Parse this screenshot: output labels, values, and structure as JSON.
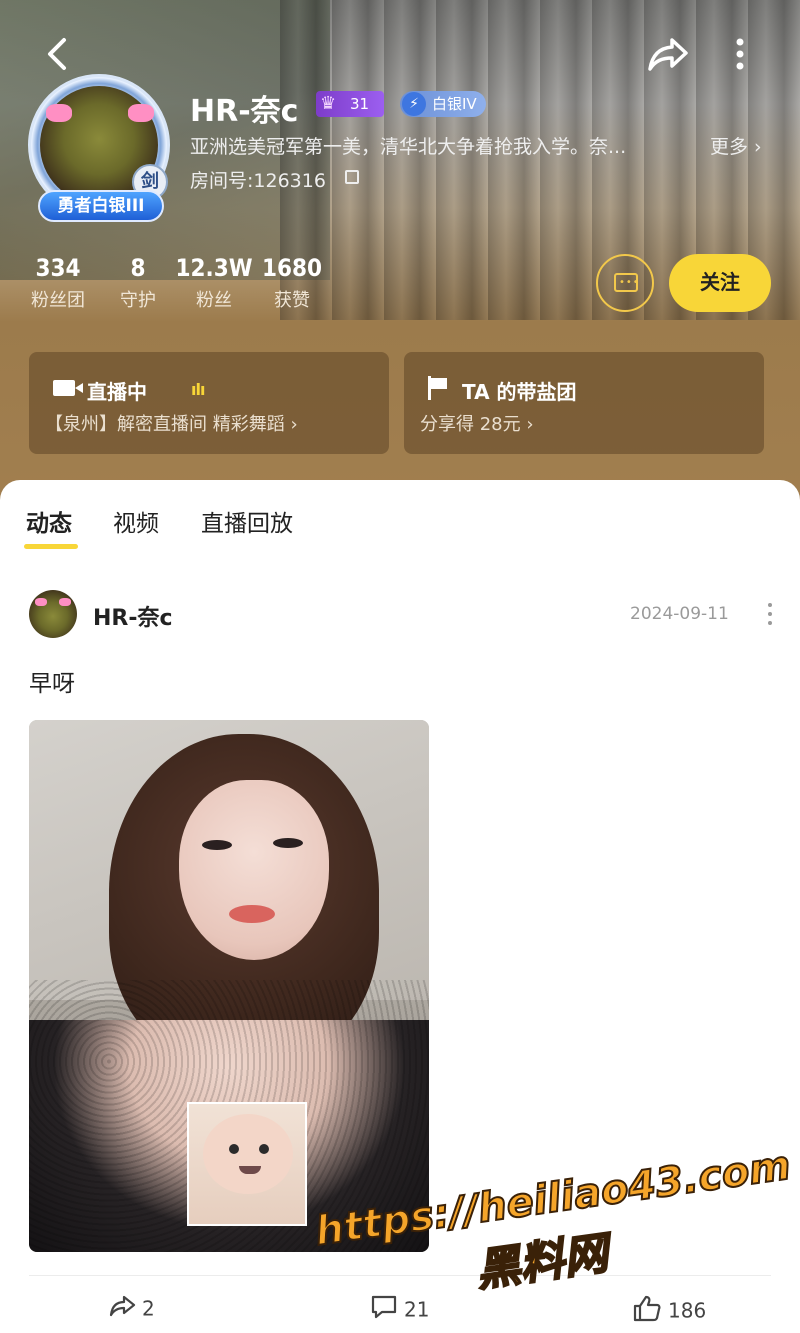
{
  "header": {
    "username": "HR-奈c",
    "level_badge": "31",
    "silver_badge": "白银IV",
    "avatar_rank_badge": "勇者白银III",
    "avatar_sword_badge": "剑",
    "bio": "亚洲选美冠军第一美，清华北大争着抢我入学。奈...",
    "bio_more": "更多 ›",
    "room_number": "房间号:126316"
  },
  "stats": [
    {
      "value": "334",
      "label": "粉丝团"
    },
    {
      "value": "8",
      "label": "守护"
    },
    {
      "value": "12.3W",
      "label": "粉丝"
    },
    {
      "value": "1680",
      "label": "获赞"
    }
  ],
  "actions": {
    "follow_label": "关注"
  },
  "cards": {
    "live": {
      "title": "直播中",
      "subtitle": "【泉州】解密直播间 精彩舞蹈 ›",
      "live_bars": "ılı"
    },
    "team": {
      "title": "TA 的带盐团",
      "subtitle": "分享得 28元 ›"
    }
  },
  "tabs": [
    {
      "label": "动态",
      "active": true
    },
    {
      "label": "视频",
      "active": false
    },
    {
      "label": "直播回放",
      "active": false
    }
  ],
  "post": {
    "author": "HR-奈c",
    "date": "2024-09-11",
    "text": "早呀",
    "shares": "2",
    "comments": "21",
    "likes": "186"
  },
  "watermark": {
    "url": "https://heiliao43.com",
    "site": "黑料网"
  },
  "colors": {
    "accent": "#f8d638",
    "card_bg": "#6a4e2c",
    "watermark": "#f5a52a"
  }
}
